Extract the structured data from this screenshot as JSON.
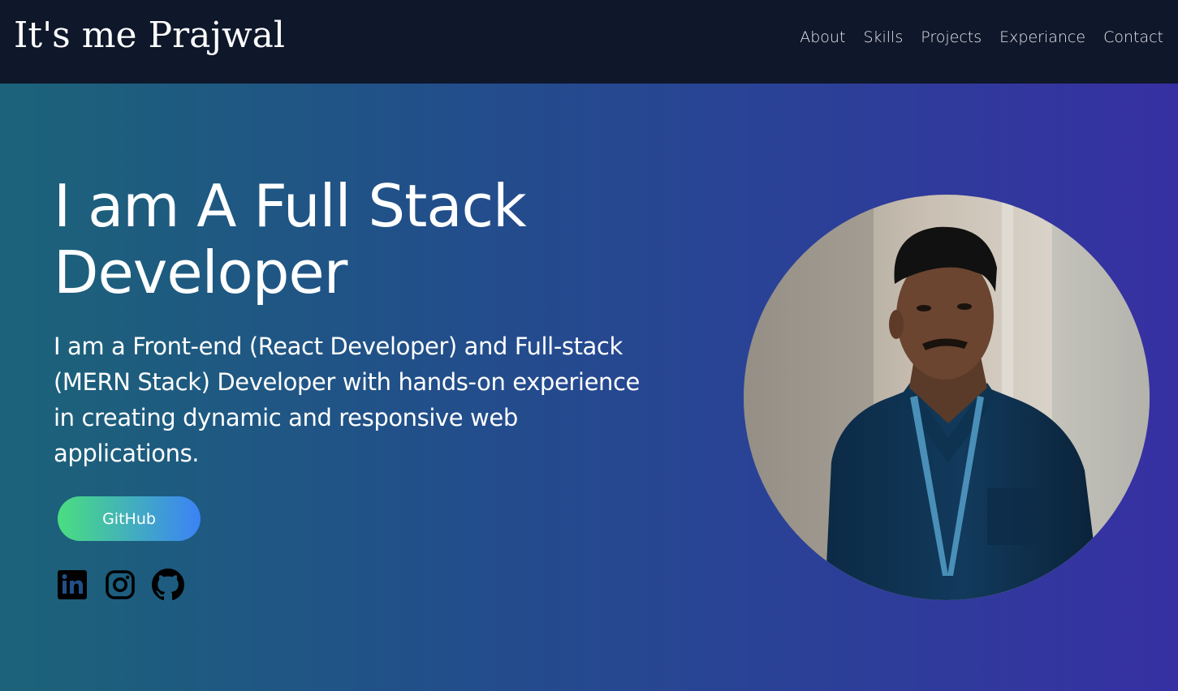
{
  "navbar": {
    "brand": "It's me Prajwal",
    "links": [
      "About",
      "Skills",
      "Projects",
      "Experiance",
      "Contact"
    ]
  },
  "hero": {
    "headline": "I am A Full Stack Developer",
    "intro": "I am a Front-end (React Developer) and Full-stack (MERN Stack) Developer with hands-on experience in creating dynamic and responsive web applications.",
    "github_button": "GitHub",
    "social_icons": [
      "linkedin-icon",
      "instagram-icon",
      "github-icon"
    ],
    "avatar_alt": "profile-photo"
  },
  "colors": {
    "nav_bg": "#0f172a",
    "hero_gradient_start": "#1c6379",
    "hero_gradient_end": "#3730a3",
    "button_gradient_start": "#4ade80",
    "button_gradient_end": "#3b82f6"
  }
}
